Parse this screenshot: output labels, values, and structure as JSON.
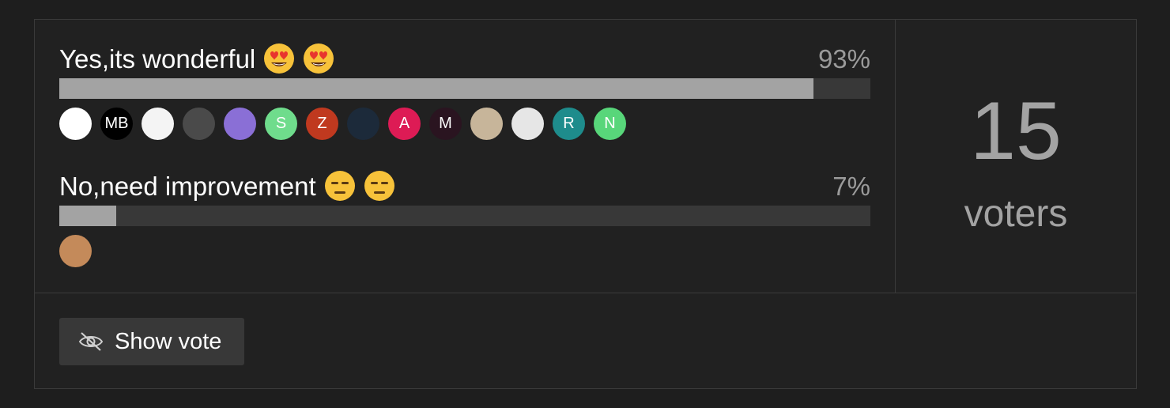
{
  "poll": {
    "options": [
      {
        "label": "Yes,its wonderful",
        "emoji": "heart-eyes-face-icon",
        "percent_text": "93%",
        "percent": 93,
        "voters": [
          {
            "initial": "",
            "bg": "#ffffff",
            "fg": "#333333"
          },
          {
            "initial": "MB",
            "bg": "#000000",
            "fg": "#ffffff"
          },
          {
            "initial": "",
            "bg": "#f4f4f4",
            "fg": "#1f4d2c"
          },
          {
            "initial": "",
            "bg": "#4a4a4a",
            "fg": "#e0a040"
          },
          {
            "initial": "",
            "bg": "#8a6fd6",
            "fg": "#ffffff"
          },
          {
            "initial": "S",
            "bg": "#6fdc8c",
            "fg": "#ffffff"
          },
          {
            "initial": "Z",
            "bg": "#c0391f",
            "fg": "#ffffff"
          },
          {
            "initial": "",
            "bg": "#1c2a3a",
            "fg": "#e0e0e0"
          },
          {
            "initial": "A",
            "bg": "#dd1b55",
            "fg": "#ffffff"
          },
          {
            "initial": "M",
            "bg": "#2a1420",
            "fg": "#ffffff"
          },
          {
            "initial": "",
            "bg": "#c7b59a",
            "fg": "#333333"
          },
          {
            "initial": "",
            "bg": "#e6e6e6",
            "fg": "#222222"
          },
          {
            "initial": "R",
            "bg": "#1e8c8c",
            "fg": "#ffffff"
          },
          {
            "initial": "N",
            "bg": "#58d67a",
            "fg": "#ffffff"
          }
        ]
      },
      {
        "label": "No,need improvement",
        "emoji": "expressionless-face-icon",
        "percent_text": "7%",
        "percent": 7,
        "voters": [
          {
            "initial": "",
            "bg": "#c48a5a",
            "fg": "#ffffff"
          }
        ]
      }
    ],
    "voter_count": "15",
    "voters_label": "voters",
    "show_vote_label": "Show vote"
  },
  "colors": {
    "background": "#1e1e1e",
    "panel": "#212121",
    "border": "#3a3a3a",
    "bar_track": "#383838",
    "bar_fill": "#a3a3a3",
    "muted_text": "#9a9a9a"
  }
}
